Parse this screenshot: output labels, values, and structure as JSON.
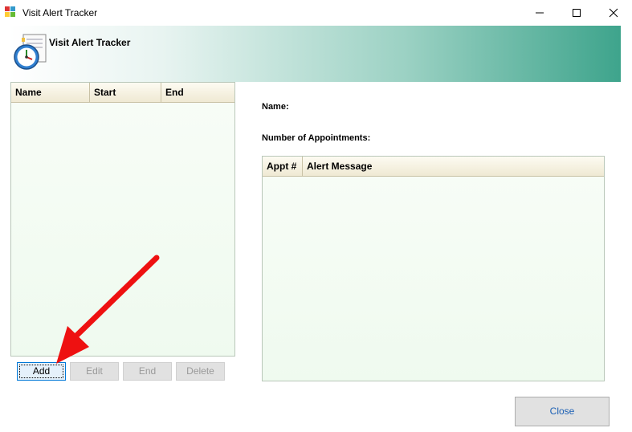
{
  "window": {
    "title": "Visit Alert Tracker"
  },
  "banner": {
    "title": "Visit Alert Tracker"
  },
  "visits_grid": {
    "columns": [
      "Name",
      "Start",
      "End"
    ]
  },
  "buttons": {
    "add": "Add",
    "edit": "Edit",
    "end": "End",
    "delete": "Delete",
    "close": "Close"
  },
  "details": {
    "name_label": "Name:",
    "appointments_label": "Number of Appointments:",
    "columns": [
      "Appt #",
      "Alert Message"
    ]
  },
  "colors": {
    "annotation_arrow": "#ee1111",
    "banner_accent": "#3ea48c"
  }
}
